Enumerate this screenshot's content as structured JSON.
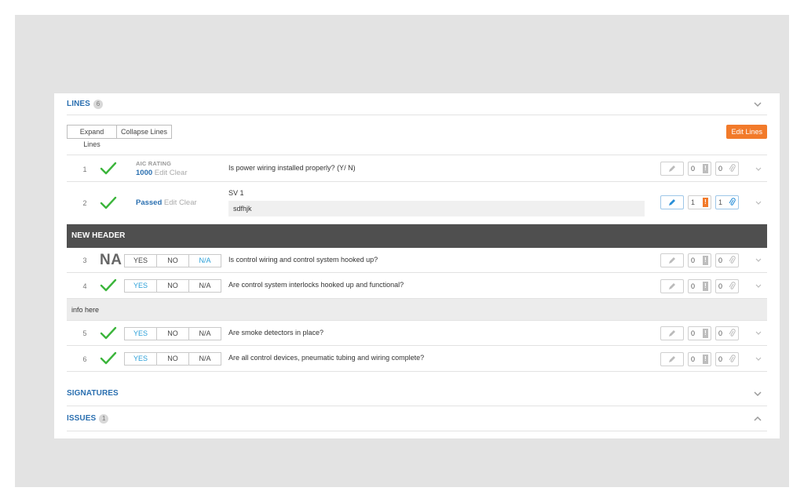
{
  "lines": {
    "title": "LINES",
    "count": "6",
    "expand_label": "Expand Lines",
    "collapse_label": "Collapse Lines",
    "edit_label": "Edit Lines",
    "accent_color": "#f27a2a",
    "rows": [
      {
        "num": "1",
        "status": "check",
        "field_label": "AIC RATING",
        "value": "1000",
        "edit": "Edit",
        "clear": "Clear",
        "question": "Is power wiring installed properly? (Y/ N)",
        "issue_count": "0",
        "attach_count": "0"
      },
      {
        "num": "2",
        "status": "check",
        "value": "Passed",
        "edit": "Edit",
        "clear": "Clear",
        "question": "SV 1",
        "comment": "sdfhjk",
        "issue_count": "1",
        "attach_count": "1"
      }
    ],
    "group_header": "NEW HEADER",
    "group_rows": [
      {
        "num": "3",
        "status": "NA",
        "yes": "YES",
        "no": "NO",
        "na": "N/A",
        "selected": "na",
        "question": "Is control wiring and control system hooked up?",
        "issue_count": "0",
        "attach_count": "0"
      },
      {
        "num": "4",
        "status": "check",
        "yes": "YES",
        "no": "NO",
        "na": "N/A",
        "selected": "yes",
        "question": "Are control system interlocks hooked up and functional?",
        "issue_count": "0",
        "attach_count": "0"
      }
    ],
    "info_text": "info here",
    "info_rows": [
      {
        "num": "5",
        "status": "check",
        "yes": "YES",
        "no": "NO",
        "na": "N/A",
        "selected": "yes",
        "question": "Are smoke detectors in place?",
        "issue_count": "0",
        "attach_count": "0"
      },
      {
        "num": "6",
        "status": "check",
        "yes": "YES",
        "no": "NO",
        "na": "N/A",
        "selected": "yes",
        "question": "Are all control devices, pneumatic tubing and wiring complete?",
        "issue_count": "0",
        "attach_count": "0"
      }
    ]
  },
  "signatures": {
    "title": "SIGNATURES"
  },
  "issues": {
    "title": "ISSUES",
    "count": "1"
  },
  "icons": {
    "check": "check-icon",
    "pencil": "pencil-icon",
    "exclamation": "exclamation-icon",
    "paperclip": "paperclip-icon",
    "chevron_down": "chevron-down-icon",
    "chevron_up": "chevron-up-icon"
  }
}
